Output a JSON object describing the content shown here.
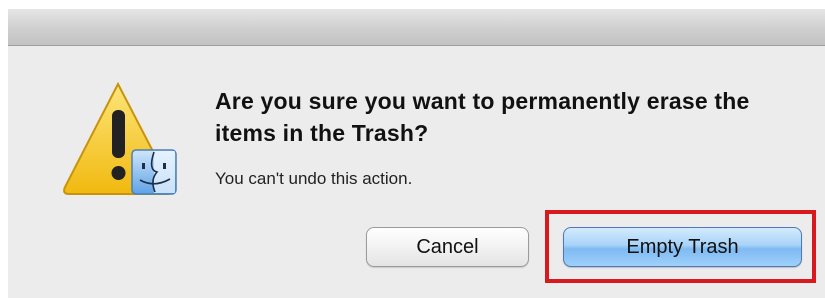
{
  "dialog": {
    "message": "Are you sure you want to permanently erase the items in the Trash?",
    "informative_text": "You can't undo this action.",
    "icon": "warning-triangle-with-finder-icon"
  },
  "buttons": {
    "cancel_label": "Cancel",
    "empty_trash_label": "Empty Trash"
  },
  "annotation": {
    "highlight_target": "empty-trash-button",
    "highlight_color": "#d81a1f"
  },
  "colors": {
    "default_button": "#9fd0fa",
    "warning_yellow": "#f5c518"
  }
}
